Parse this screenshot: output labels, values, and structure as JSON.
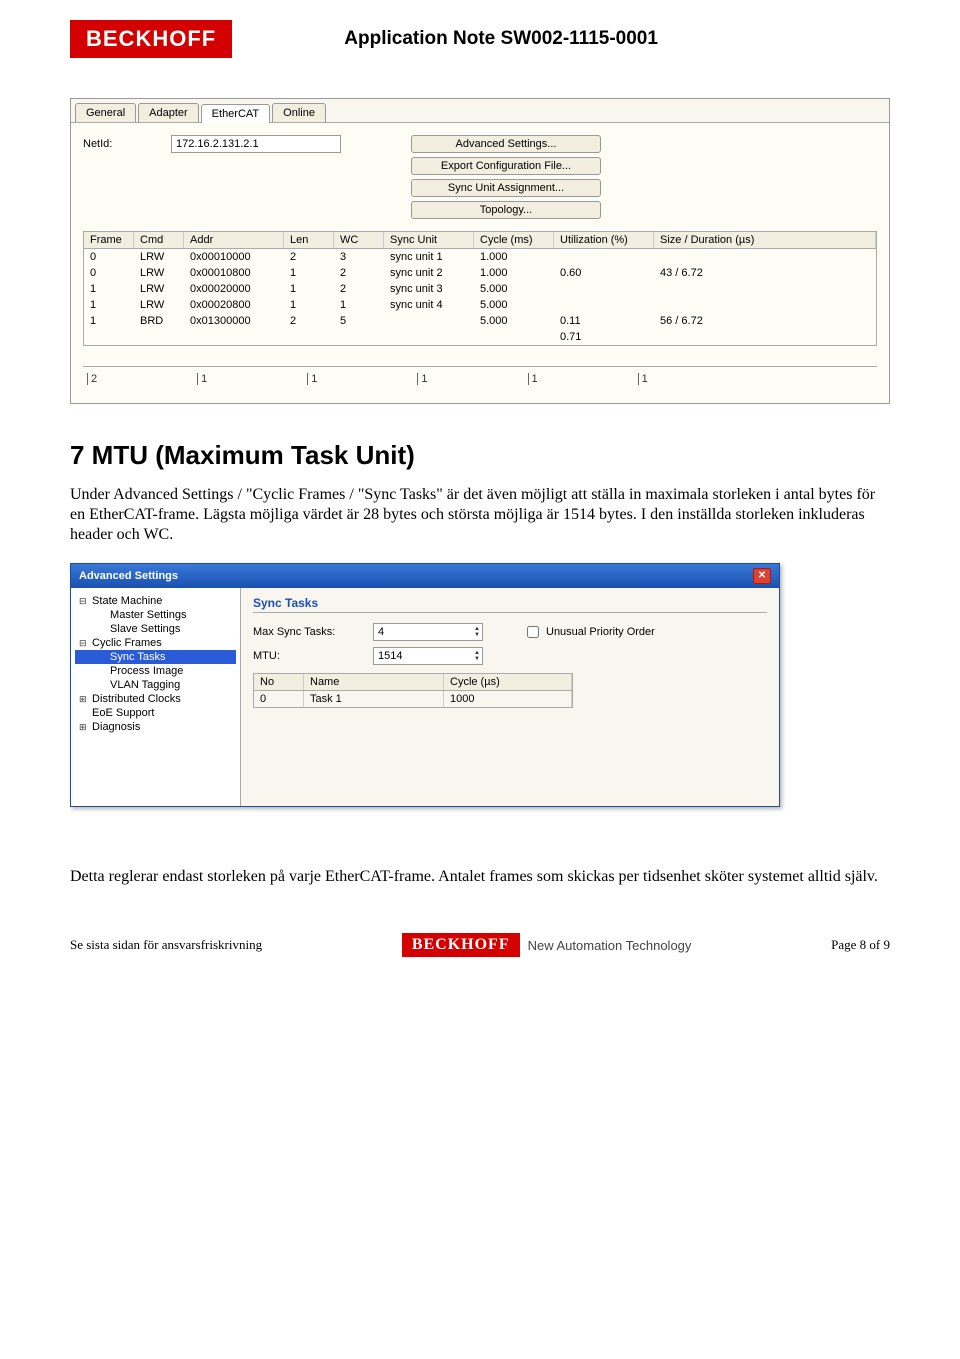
{
  "doc": {
    "brand": "BECKHOFF",
    "title": "Application Note SW002-1115-0001",
    "footer_left": "Se sista sidan för ansvarsfriskrivning",
    "footer_tag": "New Automation Technology",
    "footer_right": "Page 8 of 9"
  },
  "ss1": {
    "tabs": [
      "General",
      "Adapter",
      "EtherCAT",
      "Online"
    ],
    "active_tab": "EtherCAT",
    "netid_label": "NetId:",
    "netid_value": "172.16.2.131.2.1",
    "buttons": [
      "Advanced Settings...",
      "Export Configuration File...",
      "Sync Unit Assignment...",
      "Topology..."
    ],
    "columns": [
      "Frame",
      "Cmd",
      "Addr",
      "Len",
      "WC",
      "Sync Unit",
      "Cycle (ms)",
      "Utilization (%)",
      "Size / Duration (µs)"
    ],
    "rows": [
      {
        "frame": "0",
        "cmd": "LRW",
        "addr": "0x00010000",
        "len": "2",
        "wc": "3",
        "su": "sync unit 1",
        "cyc": "1.000",
        "util": "",
        "size": ""
      },
      {
        "frame": "0",
        "cmd": "LRW",
        "addr": "0x00010800",
        "len": "1",
        "wc": "2",
        "su": "sync unit 2",
        "cyc": "1.000",
        "util": "0.60",
        "size": "43 / 6.72"
      },
      {
        "frame": "1",
        "cmd": "LRW",
        "addr": "0x00020000",
        "len": "1",
        "wc": "2",
        "su": "sync unit 3",
        "cyc": "5.000",
        "util": "",
        "size": ""
      },
      {
        "frame": "1",
        "cmd": "LRW",
        "addr": "0x00020800",
        "len": "1",
        "wc": "1",
        "su": "sync unit 4",
        "cyc": "5.000",
        "util": "",
        "size": ""
      },
      {
        "frame": "1",
        "cmd": "BRD",
        "addr": "0x01300000",
        "len": "2",
        "wc": "5",
        "su": "",
        "cyc": "5.000",
        "util": "0.11",
        "size": "56 / 6.72"
      },
      {
        "frame": "",
        "cmd": "",
        "addr": "",
        "len": "",
        "wc": "",
        "su": "",
        "cyc": "",
        "util": "0.71",
        "size": ""
      }
    ],
    "ruler": [
      "2",
      "1",
      "1",
      "1",
      "1",
      "1"
    ]
  },
  "section": {
    "heading": "7   MTU (Maximum Task Unit)",
    "p1": "Under Advanced Settings / \"Cyclic Frames / \"Sync Tasks\" är det även möjligt att ställa in maximala storleken i antal bytes för en EtherCAT-frame. Lägsta möjliga värdet är 28 bytes och största möjliga är 1514 bytes. I den inställda storleken inkluderas header och WC.",
    "p2": "Detta reglerar endast storleken på varje EtherCAT-frame. Antalet frames som skickas per tidsenhet sköter systemet alltid själv."
  },
  "dlg": {
    "title": "Advanced Settings",
    "tree": [
      {
        "t": "State Machine",
        "sq": "⊟",
        "ind": 0
      },
      {
        "t": "Master Settings",
        "sq": "",
        "ind": 1
      },
      {
        "t": "Slave Settings",
        "sq": "",
        "ind": 1
      },
      {
        "t": "Cyclic Frames",
        "sq": "⊟",
        "ind": 0
      },
      {
        "t": "Sync Tasks",
        "sq": "",
        "ind": 1,
        "sel": true
      },
      {
        "t": "Process Image",
        "sq": "",
        "ind": 1
      },
      {
        "t": "VLAN Tagging",
        "sq": "",
        "ind": 1
      },
      {
        "t": "Distributed Clocks",
        "sq": "⊞",
        "ind": 0
      },
      {
        "t": "EoE Support",
        "sq": "",
        "ind": 0
      },
      {
        "t": "Diagnosis",
        "sq": "⊞",
        "ind": 0
      }
    ],
    "panel_title": "Sync Tasks",
    "max_label": "Max Sync Tasks:",
    "max_value": "4",
    "mtu_label": "MTU:",
    "mtu_value": "1514",
    "checkbox_label": "Unusual Priority Order",
    "mini_cols": [
      "No",
      "Name",
      "Cycle (µs)"
    ],
    "mini_rows": [
      {
        "no": "0",
        "name": "Task 1",
        "cycle": "1000"
      }
    ]
  }
}
